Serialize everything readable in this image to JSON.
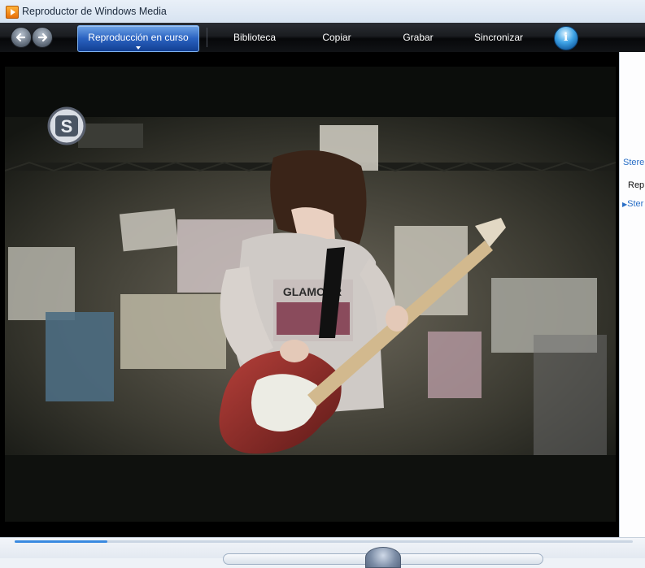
{
  "window": {
    "title": "Reproductor de Windows Media"
  },
  "navbar": {
    "tabs": [
      {
        "label": "Reproducción en curso",
        "active": true
      },
      {
        "label": "Biblioteca",
        "active": false
      },
      {
        "label": "Copiar",
        "active": false
      },
      {
        "label": "Grabar",
        "active": false
      },
      {
        "label": "Sincronizar",
        "active": false
      }
    ],
    "back_icon": "back-arrow-icon",
    "forward_icon": "forward-arrow-icon",
    "online_store_icon": "info-orb-icon"
  },
  "video": {
    "channel_logo_text": "S",
    "shirt_text": "GLAMOUR"
  },
  "right_panel": {
    "items": [
      "Stere",
      "Rep",
      "Ster"
    ]
  },
  "controls": {
    "seek_progress": 0.15
  },
  "colors": {
    "accent": "#2a62c0",
    "navbar_bg": "#111316",
    "link": "#2a6fc6"
  }
}
